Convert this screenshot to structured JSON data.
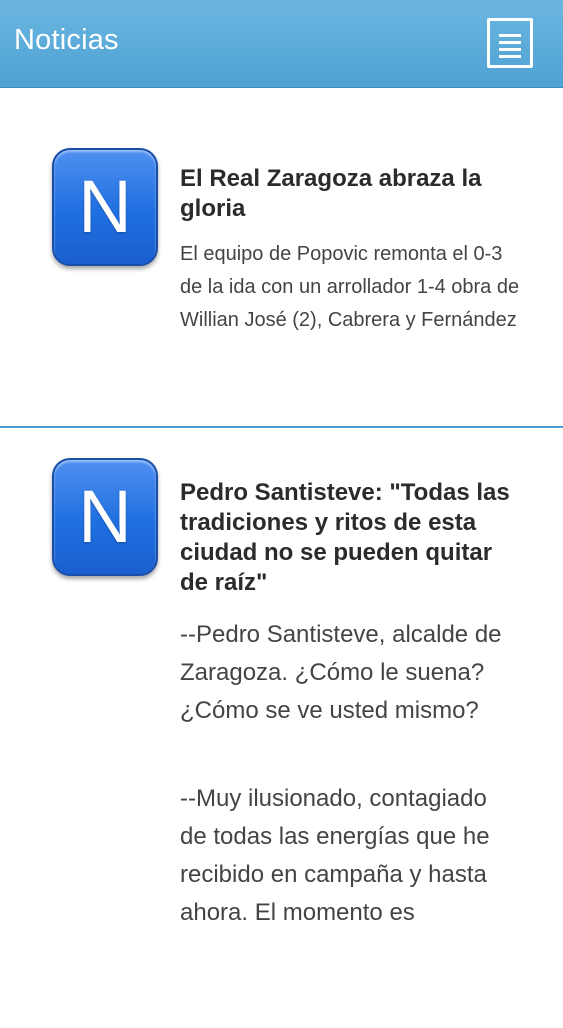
{
  "header": {
    "title": "Noticias",
    "menu_icon": "hamburger-menu-icon",
    "background_color": "#5aaad9"
  },
  "news": [
    {
      "icon_letter": "N",
      "title": "El Real Zaragoza abraza la gloria",
      "summary": "El equipo de Popovic remonta el 0-3 de la ida con un arrollador 1-4 obra de Willian José (2), Cabrera y Fernández"
    },
    {
      "icon_letter": "N",
      "title": "Pedro Santisteve: \"Todas las tradiciones y ritos de esta ciudad no se pueden quitar de raíz\"",
      "paragraphs": [
        "--Pedro Santisteve, alcalde de Zaragoza. ¿Cómo le suena? ¿Cómo se ve usted mismo?",
        "--Muy ilusionado, contagiado de todas las energías que he recibido en campaña y hasta ahora. El momento es"
      ]
    }
  ],
  "accent_color": "#4f9ad0"
}
